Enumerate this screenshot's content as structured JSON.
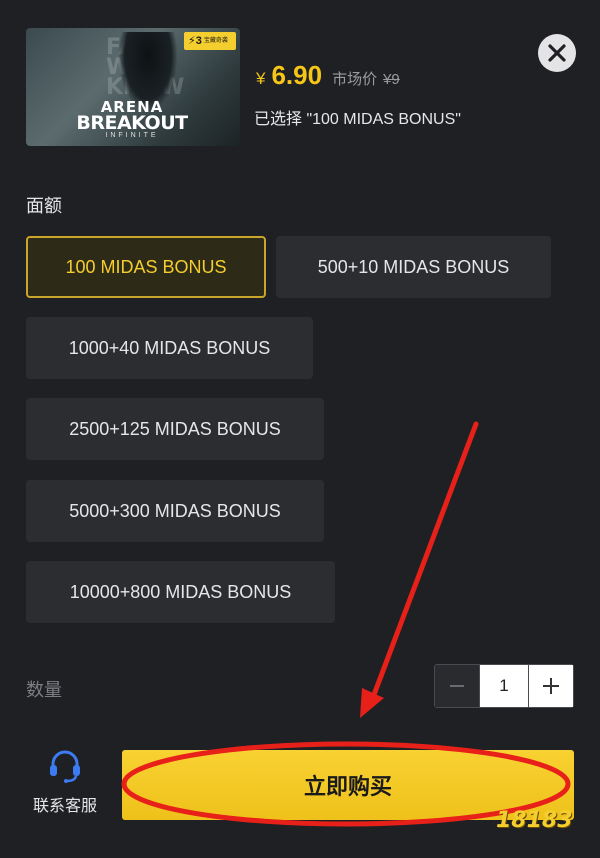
{
  "product": {
    "badge_text": "3",
    "badge_sub": "宝藏奇袭",
    "logo_top": "ARENA",
    "logo_main": "BREAKOUT",
    "logo_sub": "INFINITE",
    "bg_text": "FAR\nKNOW"
  },
  "price": {
    "currency": "¥",
    "value": "6.90",
    "market_label": "市场价",
    "market_value": "¥9"
  },
  "selected_text": "已选择 \"100 MIDAS BONUS\"",
  "denomination_label": "面额",
  "options": [
    {
      "label": "100 MIDAS BONUS",
      "selected": true
    },
    {
      "label": "500+10 MIDAS BONUS",
      "selected": false
    },
    {
      "label": "1000+40 MIDAS BONUS",
      "selected": false
    },
    {
      "label": "2500+125 MIDAS BONUS",
      "selected": false
    },
    {
      "label": "5000+300 MIDAS BONUS",
      "selected": false
    },
    {
      "label": "10000+800 MIDAS BONUS",
      "selected": false
    }
  ],
  "quantity": {
    "label": "数量",
    "value": "1"
  },
  "support": {
    "label": "联系客服",
    "icon": "headset-icon"
  },
  "buy_button": "立即购买",
  "watermark": "18183",
  "colors": {
    "accent": "#f4cd2e",
    "panel_bg": "#1f2023",
    "option_bg": "#2c2d31",
    "annotation_red": "#e8201a"
  }
}
